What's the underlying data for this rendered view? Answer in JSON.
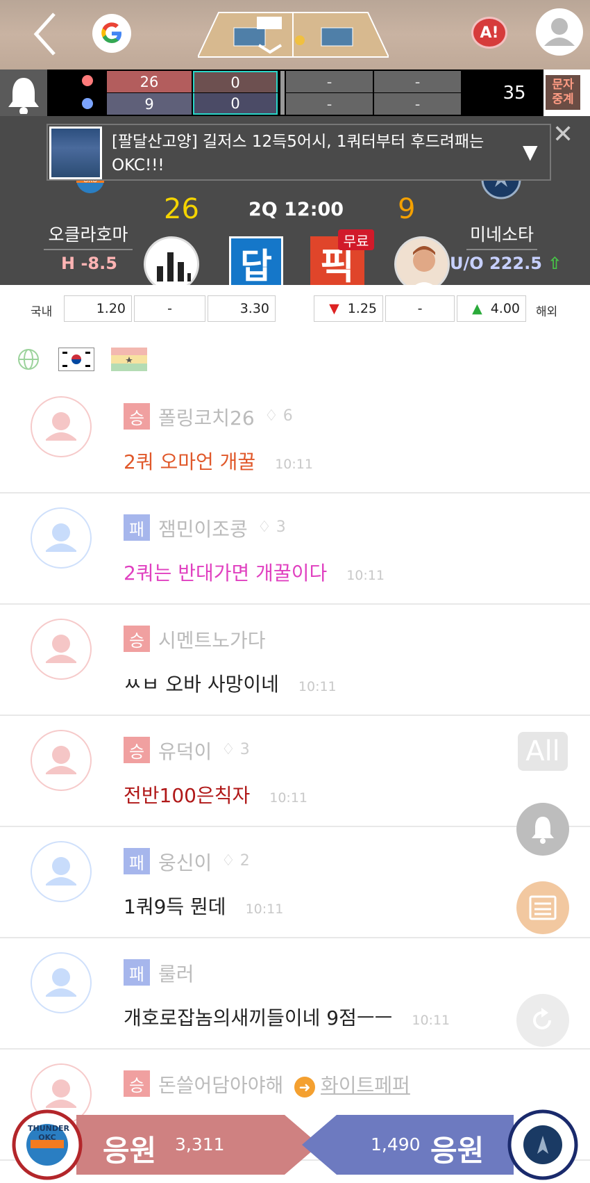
{
  "header": {
    "back_icon": "chevron-left-icon",
    "google_icon": "google-g-icon",
    "alert_label": "A!",
    "profile_icon": "user-silhouette-icon"
  },
  "scoreboard": {
    "home_color": "#ff7b7b",
    "away_color": "#7ba4ff",
    "home_q1": "26",
    "home_q2": "0",
    "away_q1": "9",
    "away_q2": "0",
    "dashes": [
      "-",
      "-",
      "-",
      "-"
    ],
    "viewer_count": "35",
    "text_relay_label": "문자 중계"
  },
  "headline": {
    "text": "[팔달산고양] 길저스 12득5어시, 1쿼터부터 후드려패는 OKC!!!",
    "toggle_icon": "triangle-down-icon",
    "close_icon": "close-icon"
  },
  "match": {
    "home_team": "오클라호마",
    "away_team": "미네소타",
    "home_score": "26",
    "away_score": "9",
    "clock": "2Q 12:00",
    "handicap": "H -8.5",
    "over_under": "U/O 222.5",
    "answer_label": "답",
    "pick_label": "픽",
    "free_label": "무료",
    "colors": {
      "home_score": "#f4d400",
      "away_score": "#f4a000",
      "answer_bg": "#1577c9",
      "pick_bg": "#e0452a"
    }
  },
  "odds": {
    "domestic_label": "국내",
    "overseas_label": "해외",
    "domestic": [
      "1.20",
      "-",
      "3.30"
    ],
    "overseas": [
      "1.25",
      "-",
      "4.00"
    ]
  },
  "chat": [
    {
      "result": "승",
      "user": "폴링코치26",
      "bell": "6",
      "message": "2쿼 오마언 개꿀",
      "time": "10:11",
      "msg_color": "#e0582a"
    },
    {
      "result": "패",
      "user": "잼민이조콩",
      "bell": "3",
      "message": "2쿼는 반대가면 개꿀이다",
      "time": "10:11",
      "msg_color": "#e040c0"
    },
    {
      "result": "승",
      "user": "시멘트노가다",
      "bell": "",
      "message": "ㅆㅂ 오바 사망이네",
      "time": "10:11",
      "msg_color": "#222222"
    },
    {
      "result": "승",
      "user": "유덕이",
      "bell": "3",
      "message": "전반100은칙자",
      "time": "10:11",
      "msg_color": "#b01818"
    },
    {
      "result": "패",
      "user": "웅신이",
      "bell": "2",
      "message": "1쿼9득 뭔데",
      "time": "10:11",
      "msg_color": "#222222"
    },
    {
      "result": "패",
      "user": "룰러",
      "bell": "",
      "message": "개호로잡놈의새끼들이네 9점ㅡㅡ",
      "time": "10:11",
      "msg_color": "#222222"
    },
    {
      "result": "승",
      "user": "돈쓸어담아야해",
      "bell": "",
      "message": "",
      "time": "",
      "msg_color": "#222222",
      "reply_to": "화이트페퍼"
    }
  ],
  "fabs": {
    "all_label": "All",
    "bell_icon": "bell-icon",
    "list_icon": "list-icon",
    "refresh_icon": "refresh-icon"
  },
  "cheer": {
    "home_label": "응원",
    "home_count": "3,311",
    "away_label": "응원",
    "away_count": "1,490",
    "home_logo": "THUNDER OKC",
    "colors": {
      "home": "#cf8181",
      "away": "#6d7ac0"
    }
  }
}
